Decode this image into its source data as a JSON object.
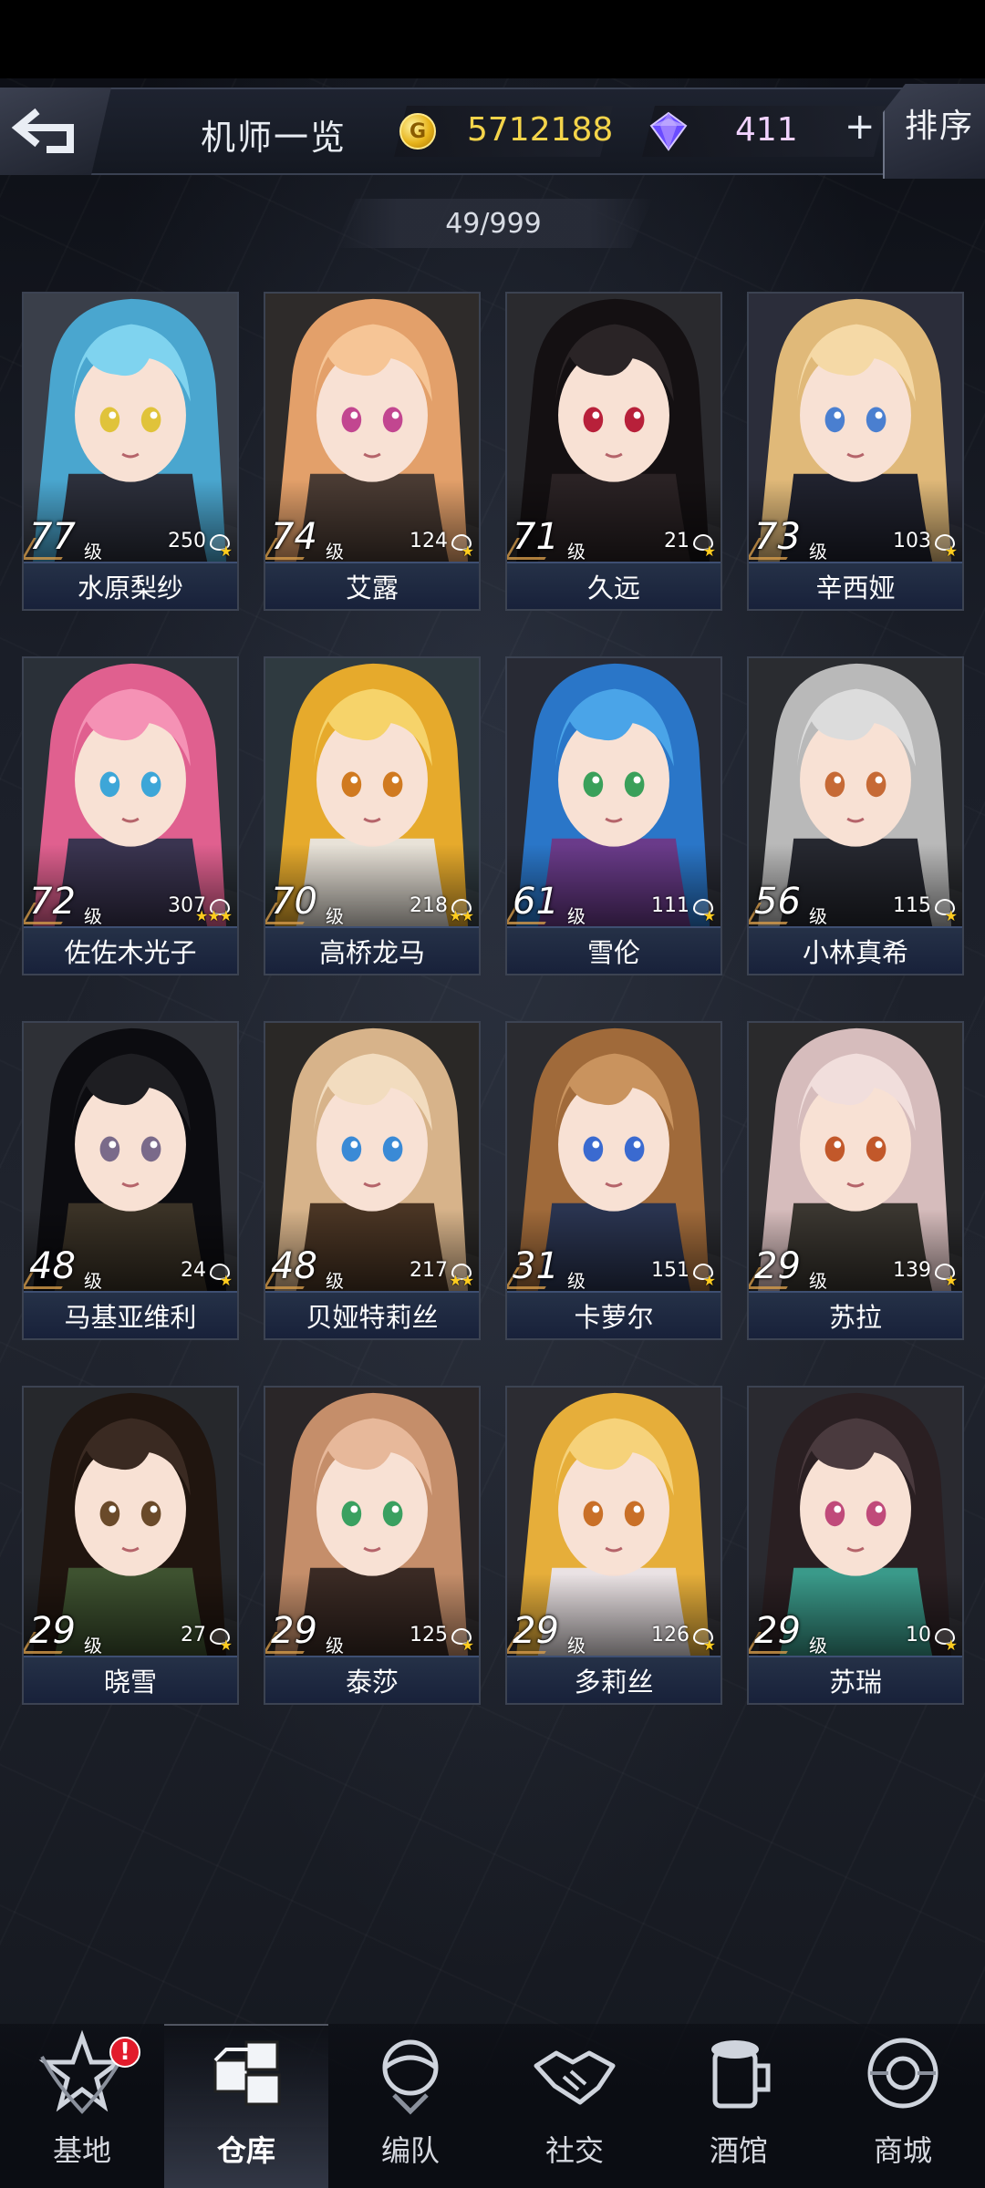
{
  "header": {
    "title": "机师一览",
    "gold": "5712188",
    "gems": "411",
    "add_label": "+",
    "sort_label": "排序",
    "count": "49/999"
  },
  "pilots": [
    {
      "name": "水原梨纱",
      "level": "77",
      "power": "250",
      "stars": 1,
      "hair": "#7fd3ef",
      "hair2": "#4aa6cf",
      "bg": "#3a3f4a",
      "eye": "#e0c33a",
      "outfit": "#2c2f3b"
    },
    {
      "name": "艾露",
      "level": "74",
      "power": "124",
      "stars": 1,
      "hair": "#f6c596",
      "hair2": "#e3a06a",
      "bg": "#2e2b2a",
      "eye": "#c24690",
      "outfit": "#4a3b33"
    },
    {
      "name": "久远",
      "level": "71",
      "power": "21",
      "stars": 1,
      "hair": "#2a2426",
      "hair2": "#141012",
      "bg": "#2a2a2e",
      "eye": "#b8203a",
      "outfit": "#2a2224"
    },
    {
      "name": "辛西娅",
      "level": "73",
      "power": "103",
      "stars": 1,
      "hair": "#f5d9a6",
      "hair2": "#e0b979",
      "bg": "#2b2d3a",
      "eye": "#4a7fd0",
      "outfit": "#20222e"
    },
    {
      "name": "佐佐木光子",
      "level": "72",
      "power": "307",
      "stars": 3,
      "hair": "#f592b5",
      "hair2": "#e0608f",
      "bg": "#2a3038",
      "eye": "#3da6d8",
      "outfit": "#3a3450"
    },
    {
      "name": "高桥龙马",
      "level": "70",
      "power": "218",
      "stars": 2,
      "hair": "#f6d36a",
      "hair2": "#e6aa2c",
      "bg": "#2f3a40",
      "eye": "#d07a20",
      "outfit": "#e8e2d8"
    },
    {
      "name": "雪伦",
      "level": "61",
      "power": "111",
      "stars": 1,
      "hair": "#4aa4e8",
      "hair2": "#2a76c8",
      "bg": "#282a34",
      "eye": "#3aa05a",
      "outfit": "#6a3b8a"
    },
    {
      "name": "小林真希",
      "level": "56",
      "power": "115",
      "stars": 1,
      "hair": "#dcdcdc",
      "hair2": "#b9b9b9",
      "bg": "#2a2c30",
      "eye": "#c66a36",
      "outfit": "#262830"
    },
    {
      "name": "马基亚维利",
      "level": "48",
      "power": "24",
      "stars": 1,
      "hair": "#1e1e22",
      "hair2": "#0c0c10",
      "bg": "#2e3036",
      "eye": "#7a6a8a",
      "outfit": "#3a3226"
    },
    {
      "name": "贝娅特莉丝",
      "level": "48",
      "power": "217",
      "stars": 2,
      "hair": "#f2dcbf",
      "hair2": "#d7b38a",
      "bg": "#2a2826",
      "eye": "#3a8ad6",
      "outfit": "#4a3524"
    },
    {
      "name": "卡萝尔",
      "level": "31",
      "power": "151",
      "stars": 1,
      "hair": "#c9935e",
      "hair2": "#a06a3a",
      "bg": "#2a2b30",
      "eye": "#3a6ad0",
      "outfit": "#2a3450"
    },
    {
      "name": "苏拉",
      "level": "29",
      "power": "139",
      "stars": 1,
      "hair": "#f1dedc",
      "hair2": "#d6bcbc",
      "bg": "#2a2a2c",
      "eye": "#c2582a",
      "outfit": "#3a3630"
    },
    {
      "name": "晓雪",
      "level": "29",
      "power": "27",
      "stars": 1,
      "hair": "#3a2a22",
      "hair2": "#20150f",
      "bg": "#26282c",
      "eye": "#6a4a2a",
      "outfit": "#3e5230"
    },
    {
      "name": "泰莎",
      "level": "29",
      "power": "125",
      "stars": 1,
      "hair": "#e7b89a",
      "hair2": "#c58e6a",
      "bg": "#2a2628",
      "eye": "#3aa060",
      "outfit": "#3a2a24"
    },
    {
      "name": "多莉丝",
      "level": "29",
      "power": "126",
      "stars": 1,
      "hair": "#f6d27a",
      "hair2": "#e6ae3a",
      "bg": "#2c2c32",
      "eye": "#c97028",
      "outfit": "#eae2e4"
    },
    {
      "name": "苏瑞",
      "level": "29",
      "power": "10",
      "stars": 1,
      "hair": "#4a3a3e",
      "hair2": "#2a1f22",
      "bg": "#2a2a30",
      "eye": "#c04a7a",
      "outfit": "#3a9a8a"
    }
  ],
  "level_unit": "级",
  "nav": [
    {
      "label": "基地",
      "icon": "base-icon",
      "active": false,
      "badge": "!"
    },
    {
      "label": "仓库",
      "icon": "warehouse-icon",
      "active": true,
      "badge": ""
    },
    {
      "label": "编队",
      "icon": "squad-icon",
      "active": false,
      "badge": ""
    },
    {
      "label": "社交",
      "icon": "handshake-icon",
      "active": false,
      "badge": ""
    },
    {
      "label": "酒馆",
      "icon": "tavern-icon",
      "active": false,
      "badge": ""
    },
    {
      "label": "商城",
      "icon": "shop-icon",
      "active": false,
      "badge": ""
    }
  ]
}
